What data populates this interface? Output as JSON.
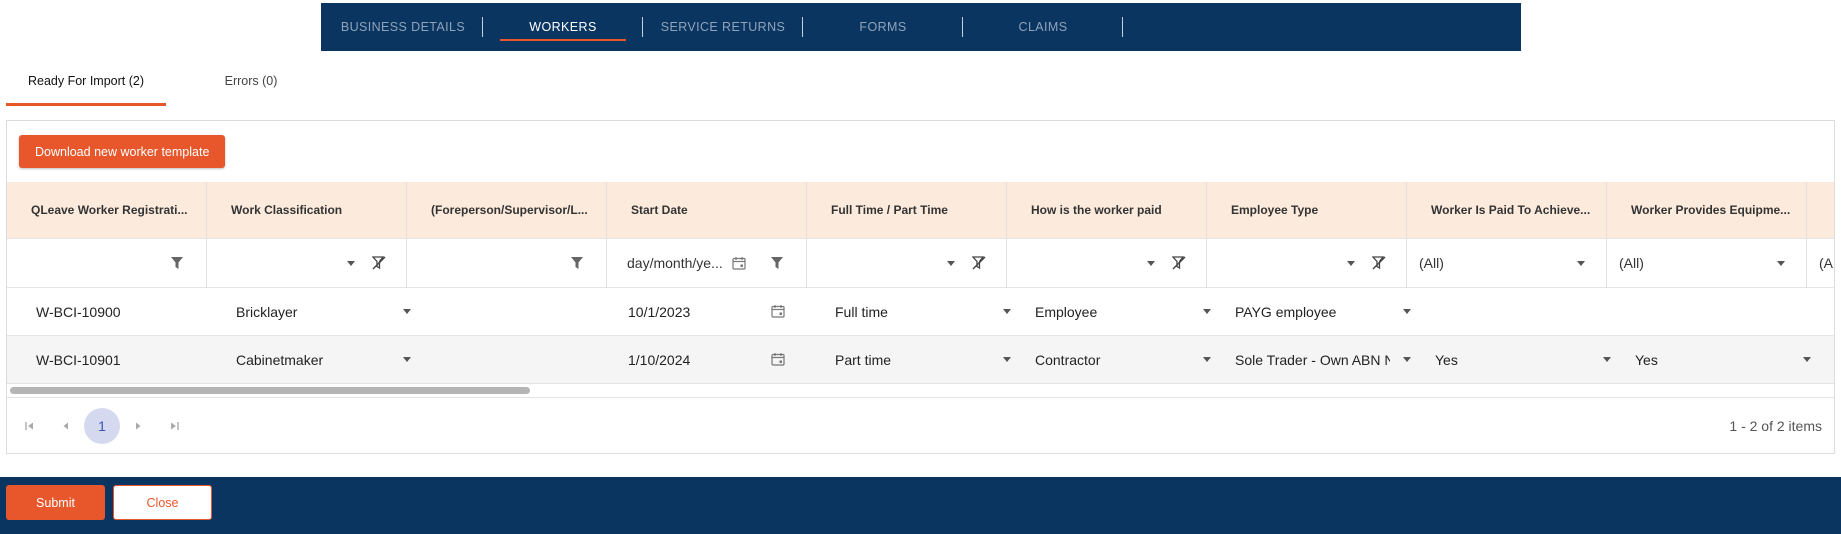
{
  "nav": {
    "tabs": [
      {
        "label": "BUSINESS DETAILS"
      },
      {
        "label": "WORKERS"
      },
      {
        "label": "SERVICE RETURNS"
      },
      {
        "label": "FORMS"
      },
      {
        "label": "CLAIMS"
      }
    ],
    "active_index": 1
  },
  "subtabs": [
    {
      "label": "Ready For Import (2)"
    },
    {
      "label": "Errors (0)"
    }
  ],
  "toolbar": {
    "download_label": "Download new worker template"
  },
  "columns": [
    "QLeave Worker Registrati...",
    "Work Classification",
    "(Foreperson/Supervisor/L...",
    "Start Date",
    "Full Time / Part Time",
    "How is the worker paid",
    "Employee Type",
    "Worker Is Paid To Achieve...",
    "Worker Provides Equipme..."
  ],
  "filters": {
    "date_placeholder": "day/month/ye...",
    "all_label": "(All)",
    "partial_label": "(A"
  },
  "rows": [
    {
      "registration": "W-BCI-10900",
      "classification": "Bricklayer",
      "supervisor": "",
      "start_date": "10/1/2023",
      "ft_pt": "Full time",
      "paid": "Employee",
      "employee_type": "PAYG employee",
      "paid_achieve": "",
      "equipment": ""
    },
    {
      "registration": "W-BCI-10901",
      "classification": "Cabinetmaker",
      "supervisor": "",
      "start_date": "1/10/2024",
      "ft_pt": "Part time",
      "paid": "Contractor",
      "employee_type": "Sole Trader - Own ABN No",
      "paid_achieve": "Yes",
      "equipment": "Yes"
    }
  ],
  "pager": {
    "current_page": "1",
    "info": "1 - 2 of 2 items"
  },
  "footer": {
    "submit_label": "Submit",
    "close_label": "Close"
  },
  "colors": {
    "navy": "#0a3560",
    "accent": "#e8572b",
    "header_bg": "#fcebdd"
  }
}
